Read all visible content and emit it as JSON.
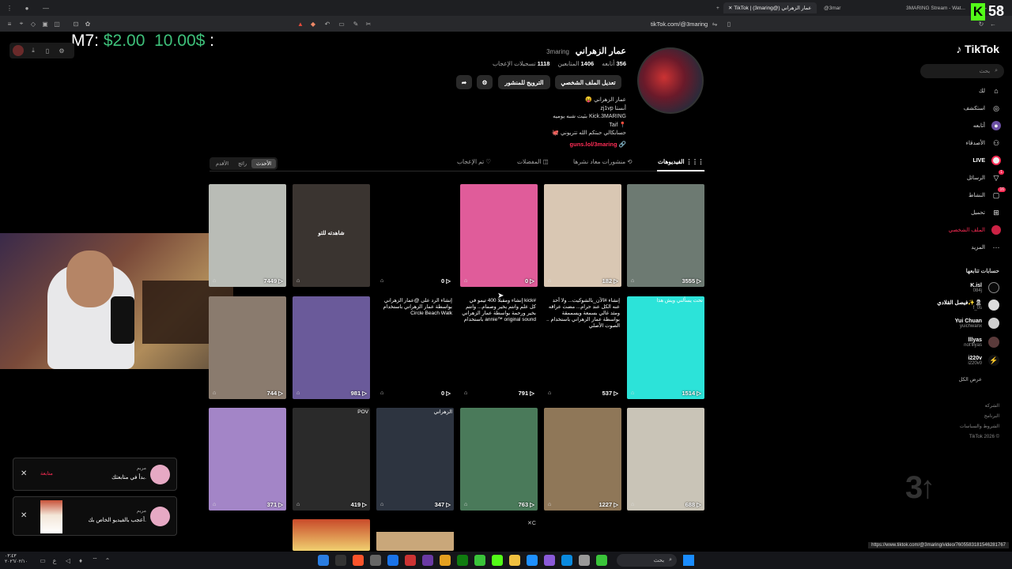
{
  "browser": {
    "tabs": [
      {
        "label": "TikTok | (3maring@) عمار الزهراني"
      },
      {
        "label": "@3mar"
      },
      {
        "label": "3MARING Stream - Wat..."
      }
    ],
    "url": "tikTok.com/@3maring",
    "status_url": "https://www.tiktok.com/@3maring/video/7605583181546281767"
  },
  "overlay": {
    "label": "M7: ",
    "amount1": "$2.00",
    "amount2": "10.00$",
    "suffix": " :"
  },
  "stream_counter": "58",
  "sidebar": {
    "logo": "TikTok",
    "search_placeholder": "بحث",
    "items": [
      {
        "label": "لك",
        "icon": "home-icon"
      },
      {
        "label": "استكشف",
        "icon": "compass-icon"
      },
      {
        "label": "أتابعه",
        "icon": "following-icon"
      },
      {
        "label": "الأصدقاء",
        "icon": "friends-icon"
      },
      {
        "label": "LIVE",
        "icon": "live-icon"
      },
      {
        "label": "الرسائل",
        "icon": "messages-icon",
        "badge": "1"
      },
      {
        "label": "النشاط",
        "icon": "activity-icon",
        "badge": "16"
      },
      {
        "label": "تحميل",
        "icon": "upload-icon"
      },
      {
        "label": "الملف الشخصي",
        "icon": "profile-icon"
      },
      {
        "label": "المزيد",
        "icon": "more-icon"
      }
    ],
    "following_title": "حسابات تتابعها",
    "following": [
      {
        "name": "K.isl",
        "handle": "084j"
      },
      {
        "name": "فيصل القلادي✨🎗",
        "handle": "f_0s"
      },
      {
        "name": "Yui Chuan",
        "handle": "yuichwanx"
      },
      {
        "name": "lllyas",
        "handle": "not'lllyas"
      },
      {
        "name": "i220v",
        "handle": "i220v0"
      }
    ],
    "show_all": "عرض الكل",
    "footer": [
      "الشركة",
      "البرنامج",
      "الشروط والسياسات",
      "TikTok 2026 ©"
    ]
  },
  "profile": {
    "name": "عمار الزهراني",
    "handle": "3maring",
    "following_count": "356",
    "following_label": "أتابعه",
    "followers_count": "1406",
    "followers_label": "المتابعين",
    "likes_count": "1118",
    "likes_label": "تسجيلات الإعجاب",
    "edit_button": "تعديل الملف الشخصي",
    "promote_button": "الترويج للمنشور",
    "bio": [
      "عمار الزهراني 😝",
      "أنستا zj1vp",
      "Kick.3MARING بثيت شبه يوميه",
      "📍 Taif",
      "حسابكالي حبتكم الله تتريوني 🐙"
    ],
    "link": "guns.lol/3maring"
  },
  "tabs": [
    {
      "label": "الفيديوهات"
    },
    {
      "label": "منشورات معاد نشرها"
    },
    {
      "label": "المفضلات"
    },
    {
      "label": "تم الإعجاب"
    }
  ],
  "sort": [
    "الأحدث",
    "رائج",
    "الأقدم"
  ],
  "videos": [
    {
      "count": "3555",
      "label": "",
      "bg": "#6d7a72"
    },
    {
      "count": "182",
      "label": "",
      "bg": "#d9c7b3"
    },
    {
      "count": "0",
      "label": "",
      "bg": "#e05c9a"
    },
    {
      "count": "0",
      "label": "",
      "bg": "#000000"
    },
    {
      "count": "",
      "label": "شاهدته للتو",
      "bg": "#3a3430"
    },
    {
      "count": "7449",
      "label": "",
      "bg": "#b9bcb6"
    },
    {
      "count": "1514",
      "label": "",
      "bg": "#2ce3d9",
      "caption": "تحت يسألني ويش هذا"
    },
    {
      "count": "537",
      "label": "",
      "bg": "#000000",
      "caption": "إنشاء #الآن_بالشوكيت... ولا أحد عنه الكل عند حرام... مضت عراقه ومثد غالي بسمعة ويسممقة بواسطة عمار الزهراني باستخدام  .. الصوت الأصلي"
    },
    {
      "count": "791",
      "label": "",
      "bg": "#000000",
      "caption": "إنشاء ومقبلا 400 تيمو في kick# كل علم وانتم بخير وصمام... وانتم بخير ورحمة بواسطة عمار الزهراني باستخدام annie™ original sound"
    },
    {
      "count": "0",
      "label": "",
      "bg": "#000000",
      "caption": "إنشاء الرد على @عمار الزهراني بواسطة عمار الزهراني باستخدام Circle Beach Walk"
    },
    {
      "count": "981",
      "label": "",
      "bg": "#6a5a9a"
    },
    {
      "count": "744",
      "label": "",
      "bg": "#8a7b6e"
    },
    {
      "count": "688",
      "label": "",
      "bg": "#c9c4b7"
    },
    {
      "count": "1227",
      "label": "",
      "bg": "#8f7758"
    },
    {
      "count": "763",
      "label": "",
      "bg": "#4a7a5a"
    },
    {
      "count": "347",
      "label": "",
      "bg": "#2d3440",
      "caption": "الزهراني"
    },
    {
      "count": "419",
      "label": "",
      "bg": "#2a2a2a",
      "caption": "POV"
    },
    {
      "count": "371",
      "label": "",
      "bg": "#a385c7"
    }
  ],
  "notifications": [
    {
      "name": "مريم",
      "text": "بدأ في متابعتك.",
      "action": "متابعة"
    },
    {
      "name": "مريم",
      "text": "أعجب بالفيديو الخاص بك."
    }
  ],
  "taskbar": {
    "time": "٠٣:٤٣",
    "date": "٢٠٢٦/٠٢/١٠",
    "search": "بحث"
  }
}
